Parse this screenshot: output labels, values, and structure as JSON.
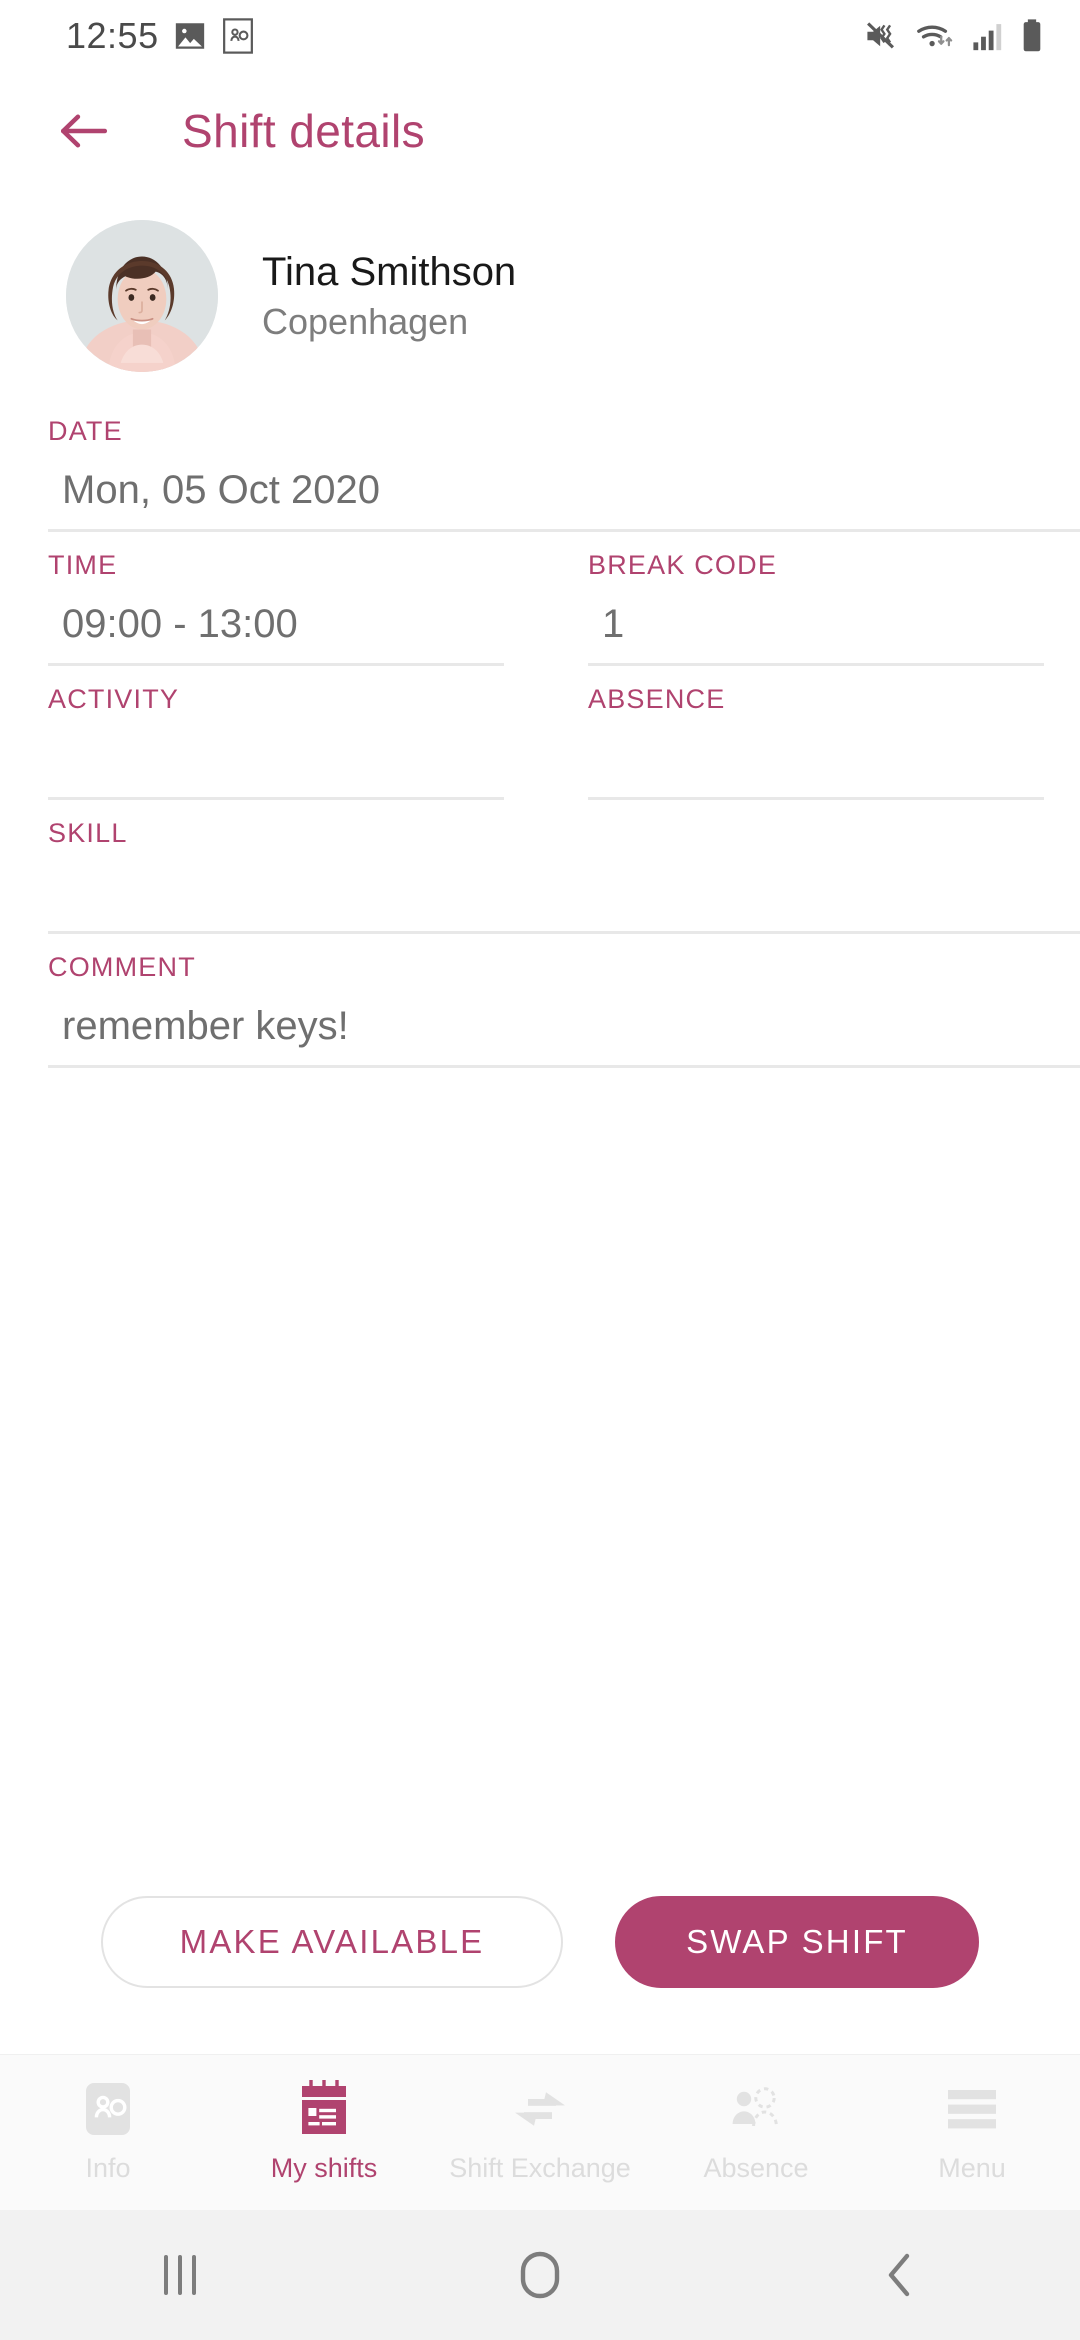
{
  "statusbar": {
    "time": "12:55",
    "left_icons": [
      "image-icon",
      "contact-card-icon"
    ],
    "right_icons": [
      "mute-vibrate-icon",
      "wifi-icon",
      "cellular-signal-icon",
      "battery-icon"
    ]
  },
  "appbar": {
    "back_icon": "back-arrow-icon",
    "title": "Shift details"
  },
  "profile": {
    "name": "Tina Smithson",
    "location": "Copenhagen"
  },
  "form": {
    "date": {
      "label": "DATE",
      "value": "Mon, 05 Oct 2020"
    },
    "time": {
      "label": "TIME",
      "value": "09:00 - 13:00"
    },
    "break_code": {
      "label": "BREAK CODE",
      "value": "1"
    },
    "activity": {
      "label": "ACTIVITY",
      "value": ""
    },
    "absence": {
      "label": "ABSENCE",
      "value": ""
    },
    "skill": {
      "label": "SKILL",
      "value": ""
    },
    "comment": {
      "label": "COMMENT",
      "value": "remember keys!"
    }
  },
  "actions": {
    "make_available": "MAKE AVAILABLE",
    "swap_shift": "SWAP SHIFT"
  },
  "bottomnav": {
    "items": [
      {
        "label": "Info",
        "icon": "info-card-icon",
        "active": false
      },
      {
        "label": "My shifts",
        "icon": "calendar-shifts-icon",
        "active": true
      },
      {
        "label": "Shift Exchange",
        "icon": "swap-arrows-icon",
        "active": false
      },
      {
        "label": "Absence",
        "icon": "absent-person-icon",
        "active": false
      },
      {
        "label": "Menu",
        "icon": "hamburger-menu-icon",
        "active": false
      }
    ]
  },
  "sysnav": {
    "recents": "recents-icon",
    "home": "home-icon",
    "back": "back-icon"
  },
  "colors": {
    "accent": "#b0436f",
    "value_text": "#6f6f6f",
    "name_text": "#191919",
    "muted": "#dcdcdc",
    "underline": "#e8e8e8"
  }
}
